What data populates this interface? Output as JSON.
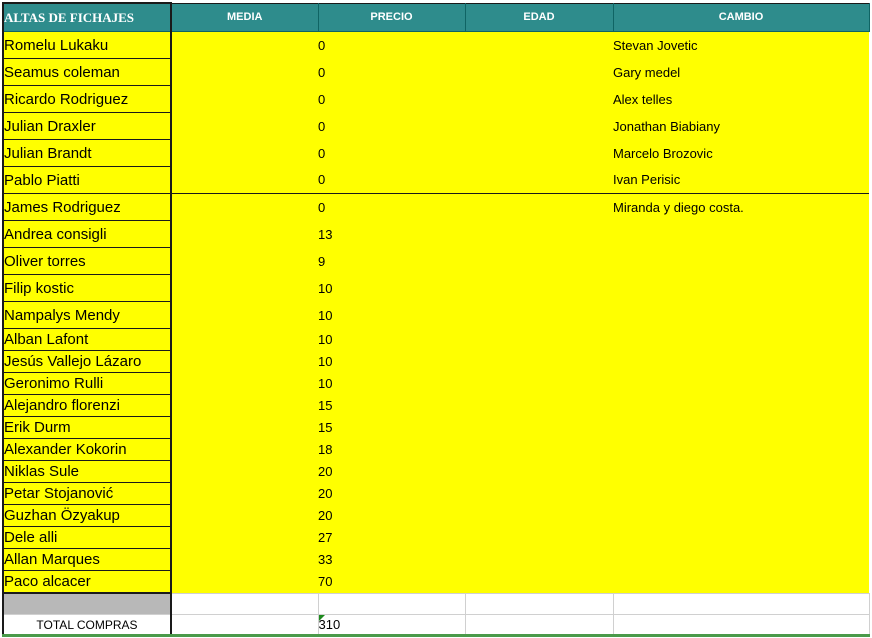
{
  "header": {
    "title": "ALTAS DE FICHAJES",
    "columns": [
      "MEDIA",
      "PRECIO",
      "EDAD",
      "CAMBIO"
    ]
  },
  "rows": [
    {
      "name": "Romelu Lukaku",
      "precio": "0",
      "cambio": "Stevan Jovetic"
    },
    {
      "name": "Seamus coleman",
      "precio": "0",
      "cambio": "Gary medel"
    },
    {
      "name": "Ricardo Rodriguez",
      "precio": "0",
      "cambio": "Alex telles"
    },
    {
      "name": "Julian Draxler",
      "precio": "0",
      "cambio": "Jonathan Biabiany"
    },
    {
      "name": "Julian Brandt",
      "precio": "0",
      "cambio": "Marcelo Brozovic"
    },
    {
      "name": "Pablo Piatti",
      "precio": "0",
      "cambio": "Ivan Perisic"
    },
    {
      "name": "James Rodriguez",
      "precio": "0",
      "cambio": "Miranda y diego costa."
    },
    {
      "name": "Andrea consigli",
      "precio": "13",
      "cambio": ""
    },
    {
      "name": "Oliver torres",
      "precio": "9",
      "cambio": ""
    },
    {
      "name": "Filip kostic",
      "precio": "10",
      "cambio": ""
    },
    {
      "name": "Nampalys Mendy",
      "precio": "10",
      "cambio": ""
    },
    {
      "name": "Alban Lafont",
      "precio": "10",
      "cambio": ""
    },
    {
      "name": "Jesús Vallejo Lázaro",
      "precio": "10",
      "cambio": ""
    },
    {
      "name": "Geronimo Rulli",
      "precio": "10",
      "cambio": ""
    },
    {
      "name": "Alejandro florenzi",
      "precio": "15",
      "cambio": ""
    },
    {
      "name": "Erik Durm",
      "precio": "15",
      "cambio": ""
    },
    {
      "name": "Alexander Kokorin",
      "precio": "18",
      "cambio": ""
    },
    {
      "name": "Niklas Sule",
      "precio": "20",
      "cambio": ""
    },
    {
      "name": "Petar Stojanović",
      "precio": "20",
      "cambio": ""
    },
    {
      "name": "Guzhan Özyakup",
      "precio": "20",
      "cambio": ""
    },
    {
      "name": "Dele alli",
      "precio": "27",
      "cambio": ""
    },
    {
      "name": "Allan Marques",
      "precio": "33",
      "cambio": ""
    },
    {
      "name": "Paco alcacer",
      "precio": "70",
      "cambio": ""
    }
  ],
  "total": {
    "label": "TOTAL COMPRAS",
    "value": "310"
  },
  "colors": {
    "header_bg": "#2e8c8c",
    "highlight": "#ffff00",
    "blank_gray": "#b8b8b8"
  }
}
